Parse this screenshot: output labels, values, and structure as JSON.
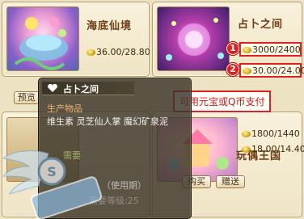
{
  "shop": {
    "items": [
      {
        "name": "海底仙境",
        "price_label": "36.00/28.80",
        "preview_label": "预览",
        "thumb_icon": "undersea-scene-thumbnail"
      },
      {
        "name": "占卜之间",
        "price_gold": "3000/2400",
        "price_yuanbao": "30.00/24.00",
        "buy_label": "购买",
        "gift_label": "赠送",
        "thumb_icon": "divination-room-thumbnail"
      },
      {
        "name": "玩偶王国",
        "price_gold": "1800/1440",
        "price_yuanbao": "18.00/14.40",
        "thumb_icon": "doll-kingdom-thumbnail"
      }
    ]
  },
  "annotations": {
    "badge_1": "1",
    "badge_2": "2",
    "callout": "可用元宝或Q币支付"
  },
  "tooltip": {
    "title": "占卜之间",
    "category": "生产物品",
    "ingredients": "维生素 灵芝仙人掌 魔幻矿泉泥",
    "faint_line_1": "需要",
    "faint_line_2": "（使用期）",
    "faint_line_3": "需要等级:25"
  },
  "colors": {
    "annotation_red": "#e02020",
    "tooltip_category": "#f0b070",
    "card_title": "#6b3b12"
  }
}
